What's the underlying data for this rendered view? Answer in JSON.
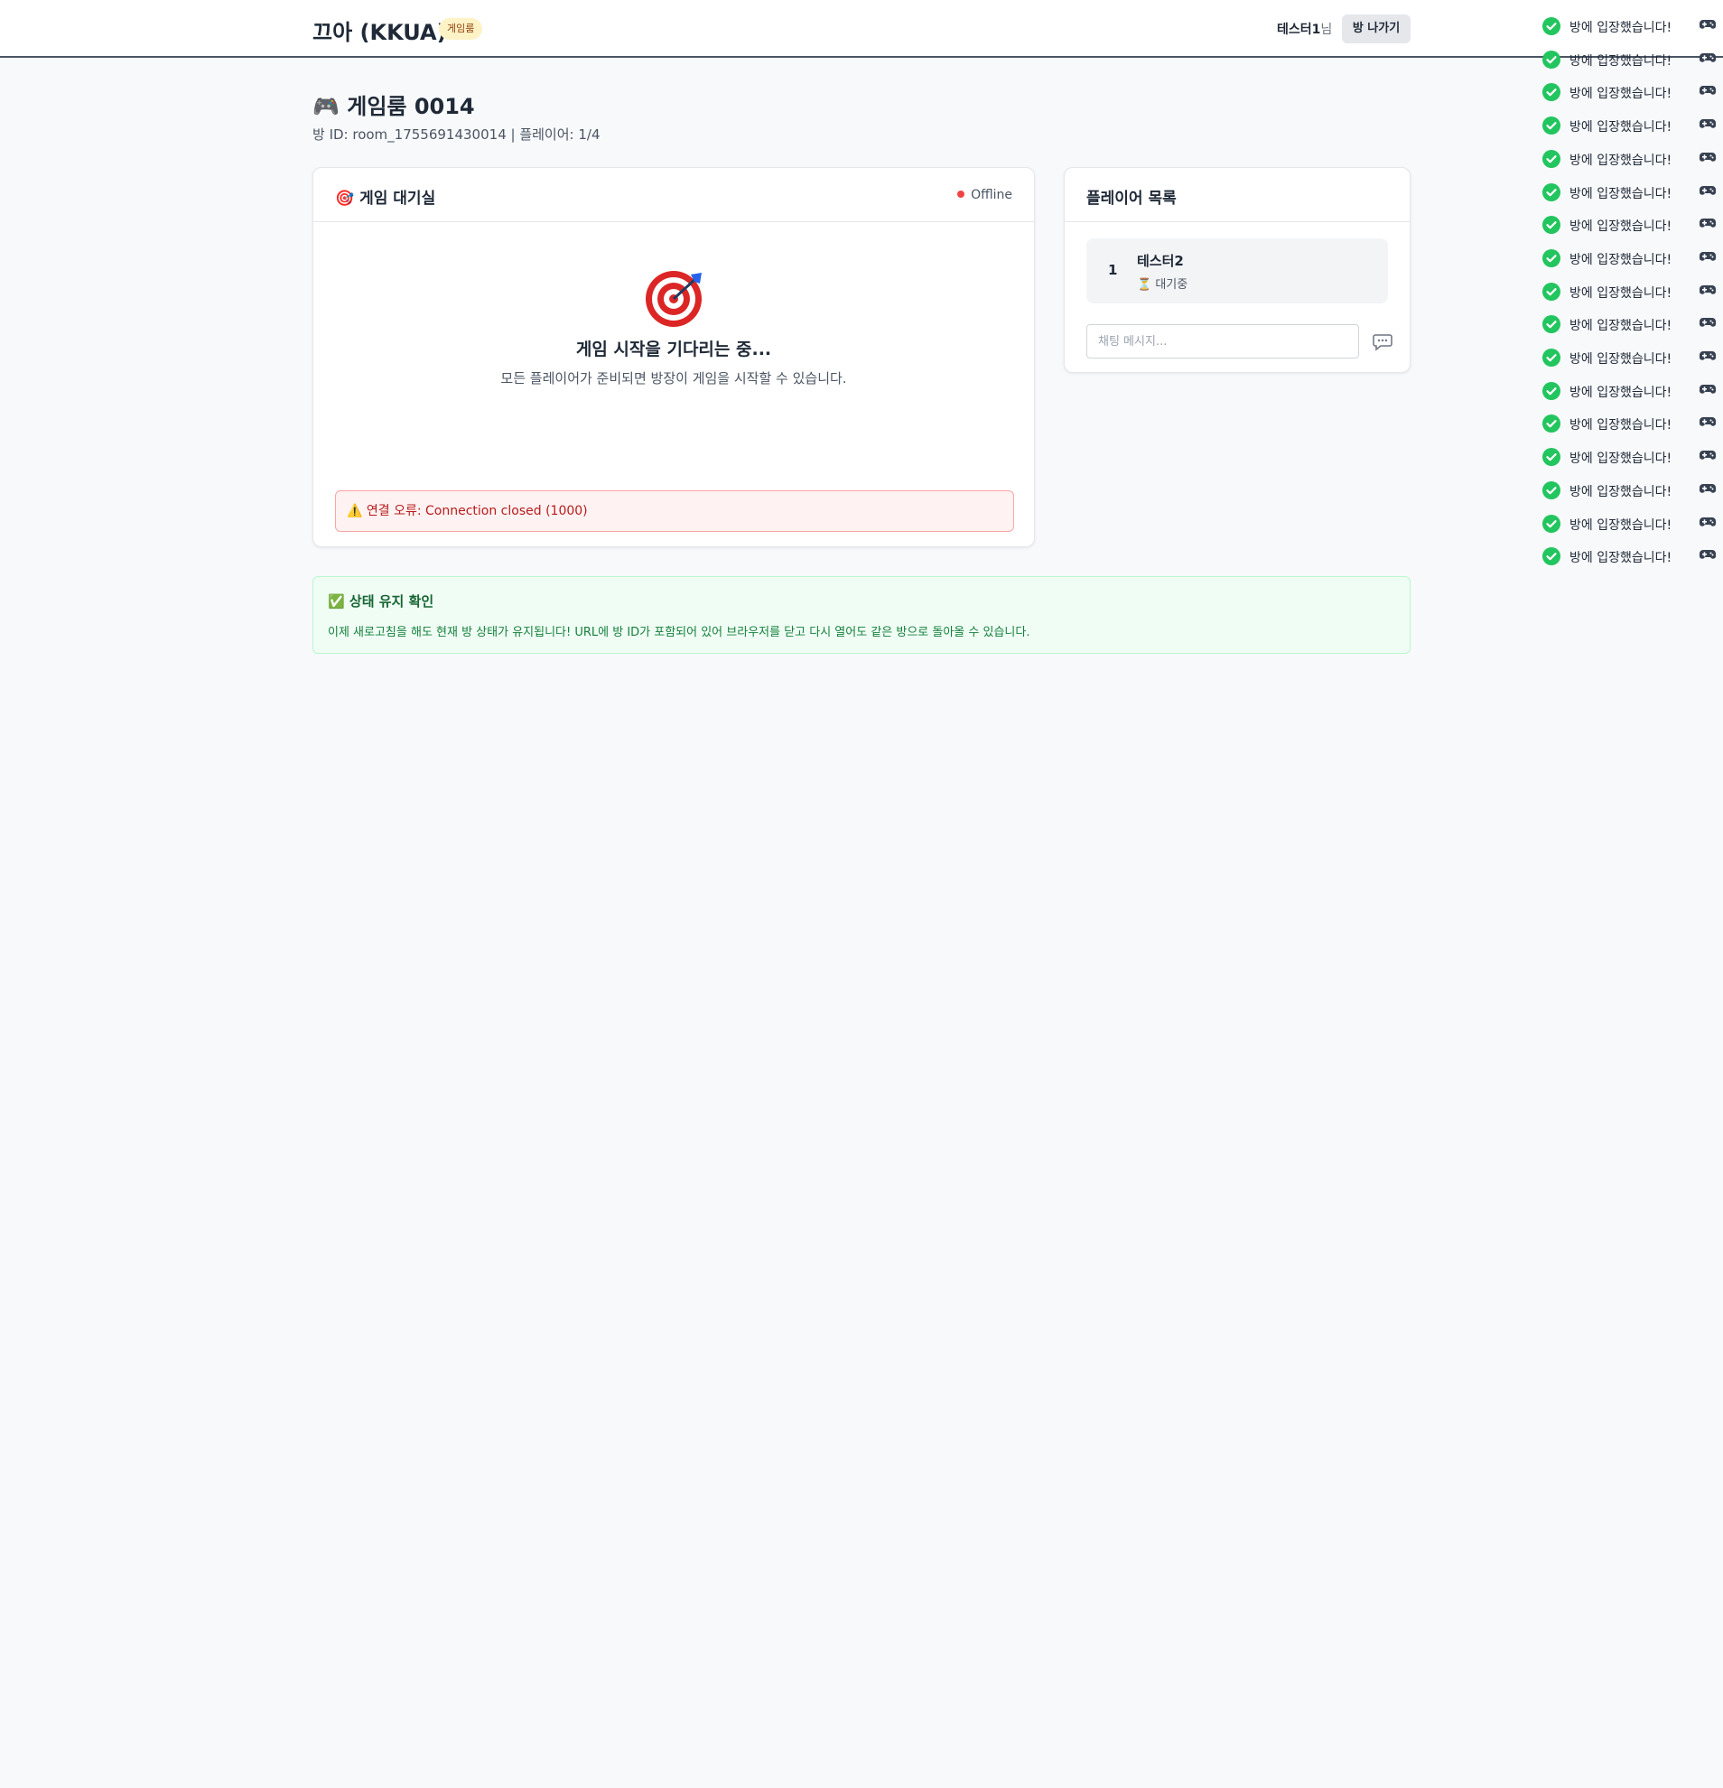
{
  "header": {
    "logo": "끄아 (KKUA)",
    "badge": "게임룸",
    "user_name": "테스터1",
    "user_suffix": "님",
    "leave_label": "방 나가기"
  },
  "room": {
    "title": "🎮 게임룸 0014",
    "subtitle": "방 ID: room_1755691430014 | 플레이어: 1/4"
  },
  "lobby": {
    "title": "🎯 게임 대기실",
    "status": "Offline",
    "wait_title": "게임 시작을 기다리는 중...",
    "wait_desc": "모든 플레이어가 준비되면 방장이 게임을 시작할 수 있습니다.",
    "error": "⚠️ 연결 오류: Connection closed (1000)"
  },
  "players": {
    "title": "플레이어 목록",
    "list": [
      {
        "number": "1",
        "name": "테스터2",
        "status": "⏳ 대기중"
      }
    ],
    "chat_placeholder": "채팅 메시지..."
  },
  "notice": {
    "title": "✅ 상태 유지 확인",
    "text": "이제 새로고침을 해도 현재 방 상태가 유지됩니다! URL에 방 ID가 포함되어 있어 브라우저를 닫고 다시 열어도 같은 방으로 돌아올 수 있습니다."
  },
  "toasts": [
    "방에 입장했습니다!",
    "방에 입장했습니다!",
    "방에 입장했습니다!",
    "방에 입장했습니다!",
    "방에 입장했습니다!",
    "방에 입장했습니다!",
    "방에 입장했습니다!",
    "방에 입장했습니다!",
    "방에 입장했습니다!",
    "방에 입장했습니다!",
    "방에 입장했습니다!",
    "방에 입장했습니다!",
    "방에 입장했습니다!",
    "방에 입장했습니다!",
    "방에 입장했습니다!",
    "방에 입장했습니다!",
    "방에 입장했습니다!"
  ],
  "colors": {
    "accent_error": "#ef4444",
    "success": "#22c55e",
    "notice_text": "#15803d"
  }
}
